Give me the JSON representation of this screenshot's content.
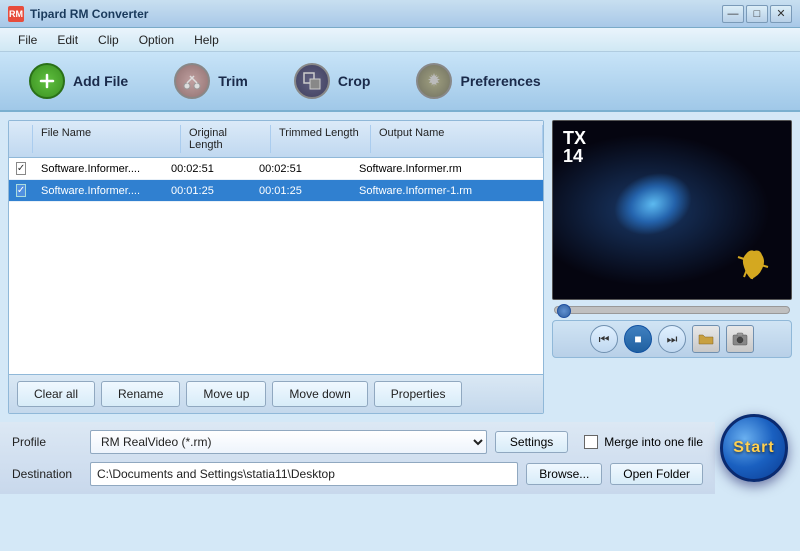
{
  "app": {
    "title": "Tipard RM Converter",
    "title_icon": "RM"
  },
  "title_controls": {
    "minimize": "—",
    "maximize": "□",
    "close": "✕"
  },
  "menu": {
    "items": [
      "File",
      "Edit",
      "Clip",
      "Option",
      "Help"
    ]
  },
  "toolbar": {
    "add_file_label": "Add File",
    "trim_label": "Trim",
    "crop_label": "Crop",
    "preferences_label": "Preferences"
  },
  "file_list": {
    "columns": [
      "File Name",
      "Original Length",
      "Trimmed Length",
      "Output Name"
    ],
    "rows": [
      {
        "checked": true,
        "selected": false,
        "filename": "Software.Informer....",
        "original_length": "00:02:51",
        "trimmed_length": "00:02:51",
        "output_name": "Software.Informer.rm"
      },
      {
        "checked": true,
        "selected": true,
        "filename": "Software.Informer....",
        "original_length": "00:01:25",
        "trimmed_length": "00:01:25",
        "output_name": "Software.Informer-1.rm"
      }
    ]
  },
  "action_buttons": {
    "clear_all": "Clear all",
    "rename": "Rename",
    "move_up": "Move up",
    "move_down": "Move down",
    "properties": "Properties"
  },
  "playback": {
    "rewind": "⏮",
    "stop": "■",
    "forward": "⏭",
    "folder": "📁",
    "camera": "📷"
  },
  "profile": {
    "label": "Profile",
    "value": "RM RealVideo (*.rm)",
    "settings_label": "Settings"
  },
  "merge": {
    "label": "Merge into one file",
    "checked": false
  },
  "destination": {
    "label": "Destination",
    "value": "C:\\Documents and Settings\\statia11\\Desktop",
    "browse_label": "Browse...",
    "open_folder_label": "Open Folder"
  },
  "start": {
    "label": "Start"
  }
}
